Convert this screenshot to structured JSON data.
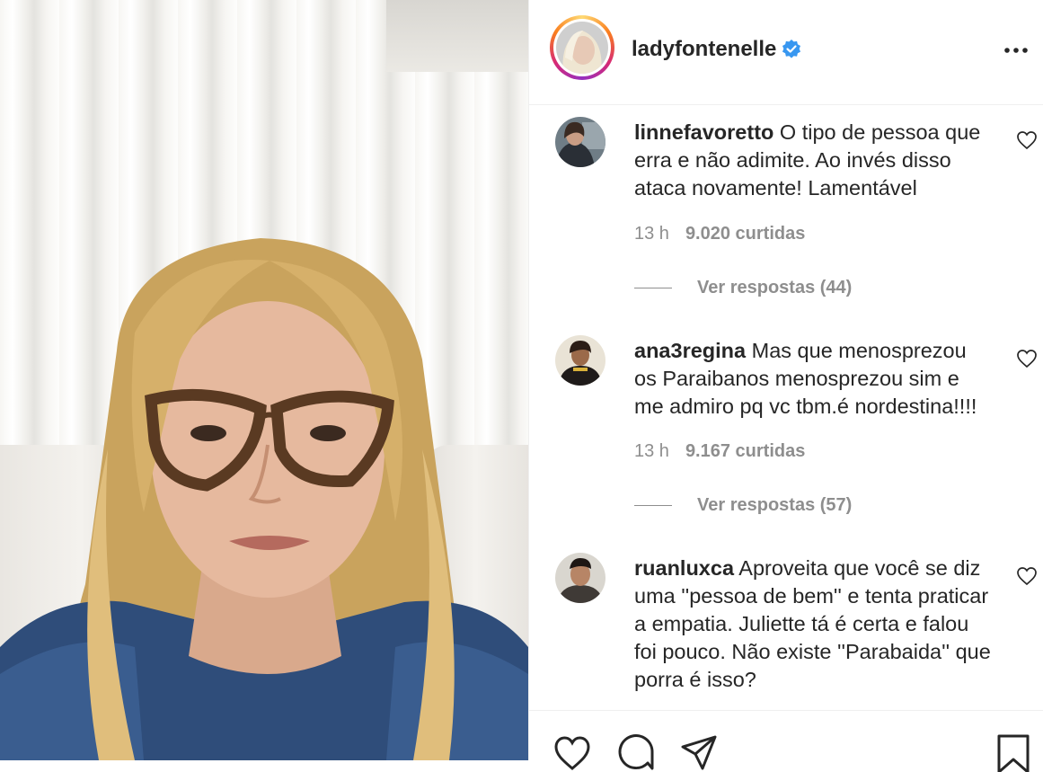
{
  "post": {
    "username": "ladyfontenelle",
    "verified": true,
    "more_icon": "more-options-icon"
  },
  "comments": [
    {
      "username": "linnefavoretto",
      "text": "O tipo de pessoa que erra e não adimite. Ao invés disso ataca novamente! Lamentável",
      "time": "13 h",
      "likes": "9.020 curtidas",
      "replies": "Ver respostas (44)"
    },
    {
      "username": "ana3regina",
      "text": "Mas que menosprezou os Paraibanos menosprezou sim e me admiro pq vc tbm.é nordestina!!!!",
      "time": "13 h",
      "likes": "9.167 curtidas",
      "replies": "Ver respostas (57)"
    },
    {
      "username": "ruanluxca",
      "text": "Aproveita que você se diz uma ''pessoa de bem'' e tenta praticar a empatia. Juliette tá é certa e falou foi pouco. Não existe ''Parabaida'' que porra é isso?"
    }
  ],
  "colors": {
    "text": "#262626",
    "secondary": "#8e8e8e",
    "verified": "#3897f0",
    "border": "#efefef"
  },
  "icons": {
    "like": "heart-icon",
    "comment": "comment-icon",
    "share": "send-icon",
    "save": "bookmark-icon"
  }
}
